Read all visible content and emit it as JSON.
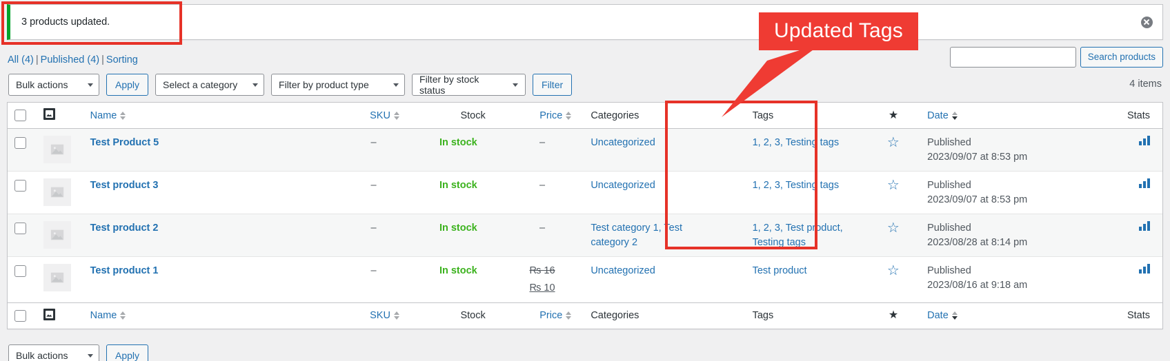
{
  "notice": {
    "message": "3 products updated.",
    "dismiss_label": "Dismiss this notice",
    "accent_color": "#00a32a"
  },
  "views": {
    "all_label": "All",
    "all_count": "(4)",
    "published_label": "Published",
    "published_count": "(4)",
    "sorting_label": "Sorting",
    "separator": "|"
  },
  "search": {
    "value": "",
    "placeholder": "",
    "button_label": "Search products"
  },
  "tablenav": {
    "bulk_actions_label": "Bulk actions",
    "apply_label": "Apply",
    "category_label": "Select a category",
    "product_type_label": "Filter by product type",
    "stock_status_label": "Filter by stock status",
    "filter_label": "Filter",
    "items_count": "4 items"
  },
  "columns": {
    "cb": "",
    "thumb": "image-icon",
    "name": "Name",
    "sku": "SKU",
    "stock": "Stock",
    "price": "Price",
    "categories": "Categories",
    "tags": "Tags",
    "featured": "★",
    "date": "Date",
    "stats": "Stats"
  },
  "rows": [
    {
      "name": "Test Product 5",
      "sku": "–",
      "stock": "In stock",
      "price_regular": "–",
      "price_sale": "",
      "categories": "Uncategorized",
      "tags": "1, 2, 3, Testing tags",
      "featured": "☆",
      "date_status": "Published",
      "date_value": "2023/09/07 at 8:53 pm",
      "stats": "bar-chart-icon"
    },
    {
      "name": "Test product 3",
      "sku": "–",
      "stock": "In stock",
      "price_regular": "–",
      "price_sale": "",
      "categories": "Uncategorized",
      "tags": "1, 2, 3, Testing tags",
      "featured": "☆",
      "date_status": "Published",
      "date_value": "2023/09/07 at 8:53 pm",
      "stats": "bar-chart-icon"
    },
    {
      "name": "Test product 2",
      "sku": "–",
      "stock": "In stock",
      "price_regular": "–",
      "price_sale": "",
      "categories": "Test category 1, Test category 2",
      "tags": "1, 2, 3, Test product, Testing tags",
      "featured": "☆",
      "date_status": "Published",
      "date_value": "2023/08/28 at 8:14 pm",
      "stats": "bar-chart-icon"
    },
    {
      "name": "Test product 1",
      "sku": "–",
      "stock": "In stock",
      "price_regular": "₨ 16",
      "price_sale": "₨ 10",
      "categories": "Uncategorized",
      "tags": "Test product",
      "featured": "☆",
      "date_status": "Published",
      "date_value": "2023/08/16 at 9:18 am",
      "stats": "bar-chart-icon"
    }
  ],
  "annotation": {
    "callout_text": "Updated Tags",
    "callout_color": "#ef3b33",
    "highlight_color": "#e63228"
  },
  "bottom": {
    "bulk_actions_label": "Bulk actions",
    "apply_label": "Apply"
  }
}
